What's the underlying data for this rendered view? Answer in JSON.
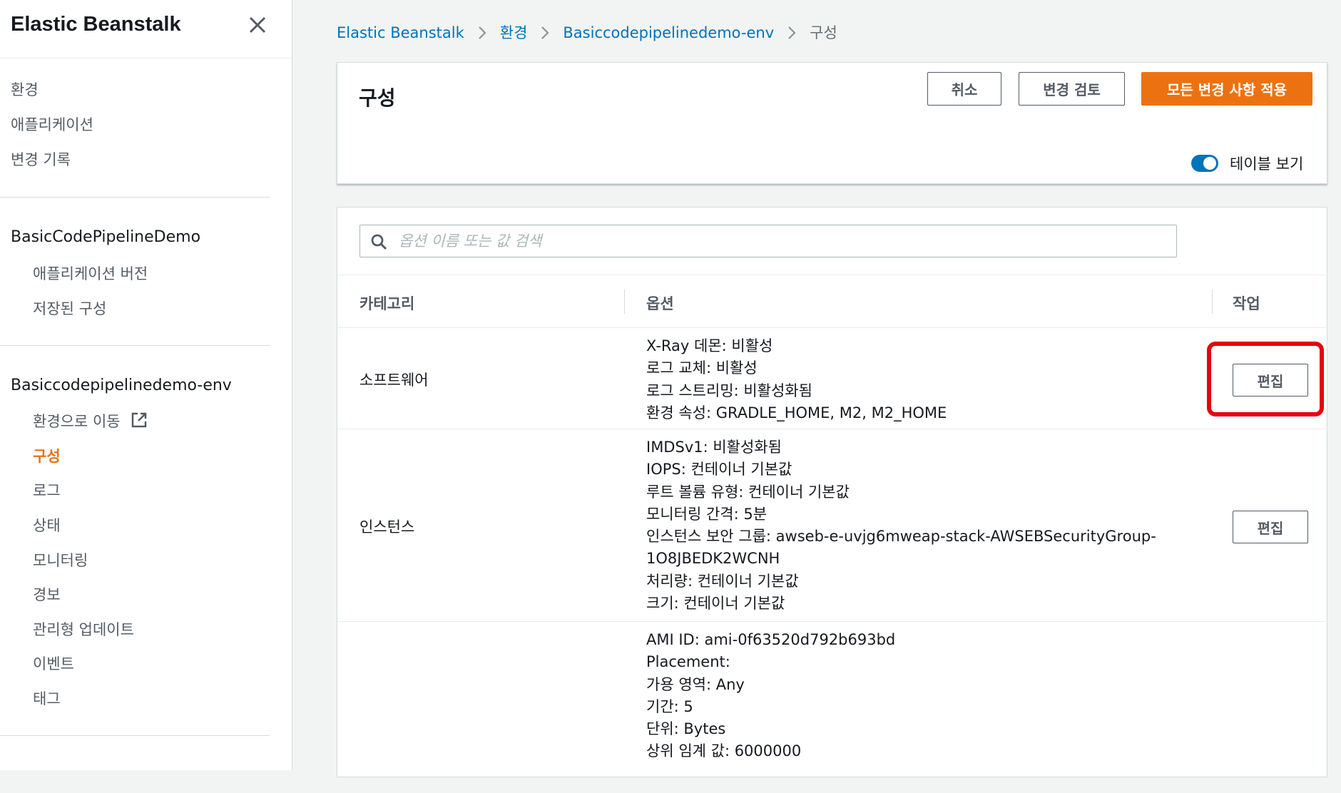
{
  "sidebar": {
    "title": "Elastic Beanstalk",
    "top_items": [
      "환경",
      "애플리케이션",
      "변경 기록"
    ],
    "app_section": "BasicCodePipelineDemo",
    "app_items": [
      "애플리케이션 버전",
      "저장된 구성"
    ],
    "env_section": "Basiccodepipelinedemo-env",
    "env_items": [
      {
        "label": "환경으로 이동"
      },
      {
        "label": "구성",
        "active": true
      },
      {
        "label": "로그"
      },
      {
        "label": "상태"
      },
      {
        "label": "모니터링"
      },
      {
        "label": "경보"
      },
      {
        "label": "관리형 업데이트"
      },
      {
        "label": "이벤트"
      },
      {
        "label": "태그"
      }
    ]
  },
  "breadcrumb": [
    "Elastic Beanstalk",
    "환경",
    "Basiccodepipelinedemo-env",
    "구성"
  ],
  "header": {
    "title": "구성",
    "cancel_label": "취소",
    "review_label": "변경 검토",
    "apply_label": "모든 변경 사항 적용",
    "toggle_label": "테이블 보기",
    "toggle_on": true
  },
  "search": {
    "placeholder": "옵션 이름 또는 값 검색",
    "value": ""
  },
  "table": {
    "columns": [
      "카테고리",
      "옵션",
      "작업"
    ],
    "rows": [
      {
        "category": "소프트웨어",
        "options": [
          "X-Ray 데몬: 비활성",
          "로그 교체: 비활성",
          "로그 스트리밍: 비활성화됨",
          "환경 속성: GRADLE_HOME, M2, M2_HOME"
        ],
        "action": "편집"
      },
      {
        "category": "인스턴스",
        "options": [
          "IMDSv1: 비활성화됨",
          "IOPS: 컨테이너 기본값",
          "루트 볼륨 유형: 컨테이너 기본값",
          "모니터링 간격: 5분",
          "인스턴스 보안 그룹: awseb-e-uvjg6mweap-stack-AWSEBSecurityGroup-",
          "1O8JBEDK2WCNH",
          "처리량: 컨테이너 기본값",
          "크기: 컨테이너 기본값"
        ],
        "action": "편집"
      },
      {
        "category": "",
        "options": [
          "AMI ID: ami-0f63520d792b693bd",
          "Placement:",
          "가용 영역: Any",
          "기간: 5",
          "단위: Bytes",
          "상위 임계 값: 6000000"
        ],
        "action": ""
      }
    ]
  },
  "colors": {
    "accent": "#ec7211",
    "link": "#0073bb",
    "highlight": "#e8000e"
  }
}
